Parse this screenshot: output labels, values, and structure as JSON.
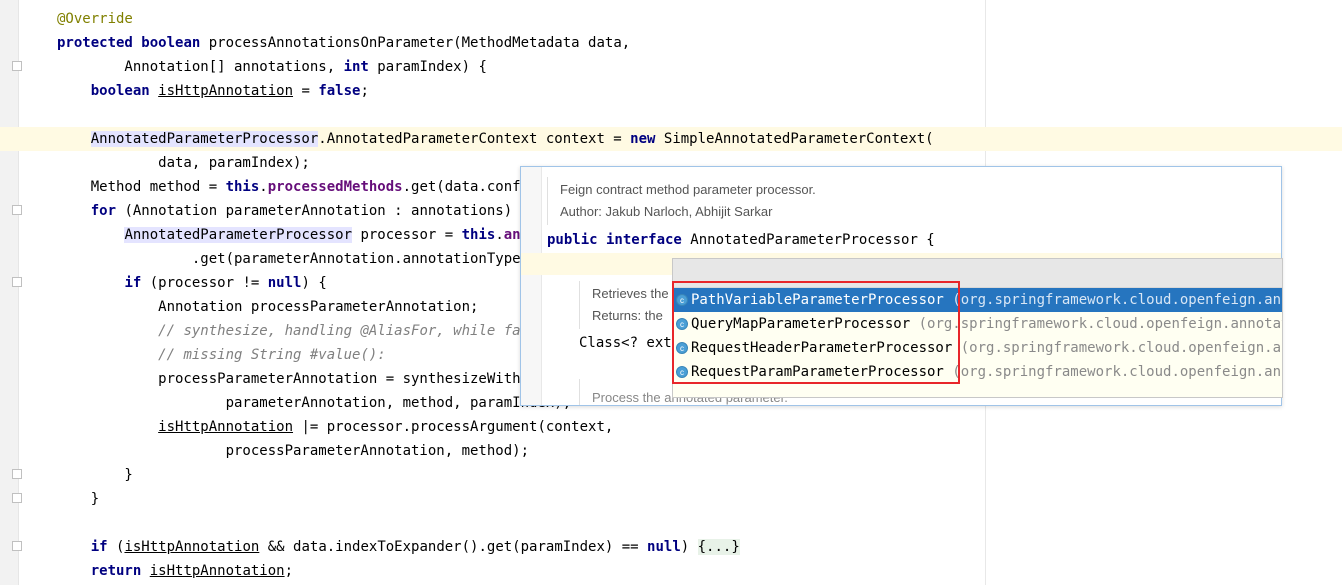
{
  "editor": {
    "lines": [
      [
        {
          "t": "@Override",
          "c": "ann"
        }
      ],
      [
        {
          "t": "protected ",
          "c": "kw"
        },
        {
          "t": "boolean ",
          "c": "kw"
        },
        {
          "t": "processAnnotationsOnParameter(MethodMetadata data,"
        }
      ],
      [
        {
          "t": "        Annotation[] annotations, "
        },
        {
          "t": "int ",
          "c": "kw"
        },
        {
          "t": "paramIndex) {"
        }
      ],
      [
        {
          "t": "    "
        },
        {
          "t": "boolean ",
          "c": "kw"
        },
        {
          "t": "isHttpAnnotation",
          "c": "ul"
        },
        {
          "t": " = "
        },
        {
          "t": "false",
          "c": "kw"
        },
        {
          "t": ";"
        }
      ],
      [
        {
          "t": ""
        }
      ],
      [
        {
          "t": "    "
        },
        {
          "t": "AnnotatedParameterProcessor",
          "c": "hl"
        },
        {
          "t": ".AnnotatedParameterContext context = "
        },
        {
          "t": "new ",
          "c": "kw"
        },
        {
          "t": "SimpleAnnotatedParameterContext("
        }
      ],
      [
        {
          "t": "            data, paramIndex);"
        }
      ],
      [
        {
          "t": "    Method method = "
        },
        {
          "t": "this",
          "c": "kw"
        },
        {
          "t": "."
        },
        {
          "t": "processedMethods",
          "c": "fld"
        },
        {
          "t": ".get(data.configK"
        }
      ],
      [
        {
          "t": "    "
        },
        {
          "t": "for ",
          "c": "kw"
        },
        {
          "t": "(Annotation parameterAnnotation : annotations) {"
        }
      ],
      [
        {
          "t": "        "
        },
        {
          "t": "AnnotatedParameterProcessor",
          "c": "hl"
        },
        {
          "t": " processor = "
        },
        {
          "t": "this",
          "c": "kw"
        },
        {
          "t": "."
        },
        {
          "t": "annot",
          "c": "fld"
        }
      ],
      [
        {
          "t": "                .get(parameterAnnotation.annotationType())"
        }
      ],
      [
        {
          "t": "        "
        },
        {
          "t": "if ",
          "c": "kw"
        },
        {
          "t": "(processor != "
        },
        {
          "t": "null",
          "c": "kw"
        },
        {
          "t": ") {"
        }
      ],
      [
        {
          "t": "            Annotation processParameterAnnotation;"
        }
      ],
      [
        {
          "t": "            "
        },
        {
          "t": "// synthesize, handling @AliasFor, while falli",
          "c": "cmt"
        }
      ],
      [
        {
          "t": "            "
        },
        {
          "t": "// missing String #value():",
          "c": "cmt"
        }
      ],
      [
        {
          "t": "            processParameterAnnotation = synthesizeWithMet"
        }
      ],
      [
        {
          "t": "                    parameterAnnotation, method, paramIndex);"
        }
      ],
      [
        {
          "t": "            "
        },
        {
          "t": "isHttpAnnotation",
          "c": "ul"
        },
        {
          "t": " |= processor.processArgument(context,"
        }
      ],
      [
        {
          "t": "                    processParameterAnnotation, method);"
        }
      ],
      [
        {
          "t": "        }"
        }
      ],
      [
        {
          "t": "    }"
        }
      ],
      [
        {
          "t": ""
        }
      ],
      [
        {
          "t": "    "
        },
        {
          "t": "if ",
          "c": "kw"
        },
        {
          "t": "("
        },
        {
          "t": "isHttpAnnotation",
          "c": "ul"
        },
        {
          "t": " && data.indexToExpander().get(paramIndex) == "
        },
        {
          "t": "null",
          "c": "kw"
        },
        {
          "t": ") "
        },
        {
          "t": "{...}",
          "c": "fold-chip"
        }
      ],
      [
        {
          "t": "    "
        },
        {
          "t": "return ",
          "c": "kw"
        },
        {
          "t": "isHttpAnnotation",
          "c": "ul"
        },
        {
          "t": ";"
        }
      ]
    ]
  },
  "doc_popup": {
    "description": "Feign contract method parameter processor.",
    "author": "Author: Jakub Narloch, Abhijit Sarkar",
    "declaration_kw": "public interface ",
    "declaration_name": "AnnotatedParameterProcessor {",
    "retrieves": "Retrieves the",
    "returns": "Returns: the",
    "class_code": "Class<? exte",
    "process": "Process the annotated parameter."
  },
  "completion": {
    "items": [
      {
        "name": "PathVariableParameterProcessor",
        "pkg": "(org.springframework.cloud.openfeign.annota",
        "selected": true
      },
      {
        "name": "QueryMapParameterProcessor",
        "pkg": "(org.springframework.cloud.openfeign.annotation",
        "selected": false
      },
      {
        "name": "RequestHeaderParameterProcessor",
        "pkg": "(org.springframework.cloud.openfeign.annot",
        "selected": false
      },
      {
        "name": "RequestParamParameterProcessor",
        "pkg": "(org.springframework.cloud.openfeign.annota",
        "selected": false
      }
    ],
    "icon_glyph": "c"
  }
}
